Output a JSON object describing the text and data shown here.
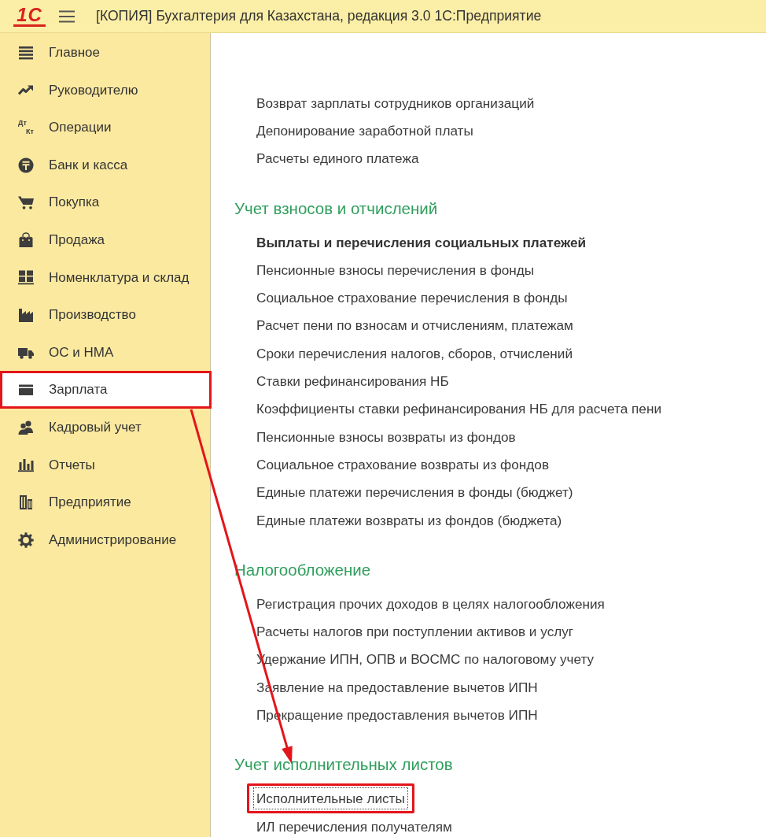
{
  "window": {
    "logo": "1С",
    "title": "[КОПИЯ] Бухгалтерия для Казахстана, редакция 3.0 1С:Предприятие"
  },
  "sidebar": {
    "items": [
      {
        "label": "Главное",
        "selected": false,
        "highlighted": false
      },
      {
        "label": "Руководителю",
        "selected": false,
        "highlighted": false
      },
      {
        "label": "Операции",
        "icon_text": [
          "Дт",
          "Кт"
        ],
        "selected": false,
        "highlighted": false
      },
      {
        "label": "Банк и касса",
        "selected": false,
        "highlighted": false
      },
      {
        "label": "Покупка",
        "selected": false,
        "highlighted": false
      },
      {
        "label": "Продажа",
        "selected": false,
        "highlighted": false
      },
      {
        "label": "Номенклатура и склад",
        "selected": false,
        "highlighted": false
      },
      {
        "label": "Производство",
        "selected": false,
        "highlighted": false
      },
      {
        "label": "ОС и НМА",
        "selected": false,
        "highlighted": false
      },
      {
        "label": "Зарплата",
        "selected": true,
        "highlighted": true
      },
      {
        "label": "Кадровый учет",
        "selected": false,
        "highlighted": false
      },
      {
        "label": "Отчеты",
        "selected": false,
        "highlighted": false
      },
      {
        "label": "Предприятие",
        "selected": false,
        "highlighted": false
      },
      {
        "label": "Администрирование",
        "selected": false,
        "highlighted": false
      }
    ]
  },
  "content": {
    "groups": [
      {
        "items": [
          {
            "label": "Возврат зарплаты сотрудников организаций",
            "bold": false,
            "focused": false,
            "highlighted": false
          },
          {
            "label": "Депонирование заработной платы",
            "bold": false,
            "focused": false,
            "highlighted": false
          },
          {
            "label": "Расчеты единого платежа",
            "bold": false,
            "focused": false,
            "highlighted": false
          }
        ]
      },
      {
        "heading": "Учет взносов и отчислений",
        "items": [
          {
            "label": "Выплаты и перечисления социальных платежей",
            "bold": true,
            "focused": false,
            "highlighted": false
          },
          {
            "label": "Пенсионные взносы перечисления в фонды",
            "bold": false,
            "focused": false,
            "highlighted": false
          },
          {
            "label": "Социальное страхование перечисления в фонды",
            "bold": false,
            "focused": false,
            "highlighted": false
          },
          {
            "label": "Расчет пени по взносам и отчислениям, платежам",
            "bold": false,
            "focused": false,
            "highlighted": false
          },
          {
            "label": "Сроки перечисления налогов, сборов, отчислений",
            "bold": false,
            "focused": false,
            "highlighted": false
          },
          {
            "label": "Ставки рефинансирования НБ",
            "bold": false,
            "focused": false,
            "highlighted": false
          },
          {
            "label": "Коэффициенты ставки рефинансирования НБ для расчета пени",
            "bold": false,
            "focused": false,
            "highlighted": false
          },
          {
            "label": "Пенсионные взносы возвраты из фондов",
            "bold": false,
            "focused": false,
            "highlighted": false
          },
          {
            "label": "Социальное страхование возвраты из фондов",
            "bold": false,
            "focused": false,
            "highlighted": false
          },
          {
            "label": "Единые платежи перечисления в фонды (бюджет)",
            "bold": false,
            "focused": false,
            "highlighted": false
          },
          {
            "label": "Единые платежи возвраты из фондов (бюджета)",
            "bold": false,
            "focused": false,
            "highlighted": false
          }
        ]
      },
      {
        "heading": "Налогообложение",
        "items": [
          {
            "label": "Регистрация прочих доходов в целях налогообложения",
            "bold": false,
            "focused": false,
            "highlighted": false
          },
          {
            "label": "Расчеты налогов при поступлении активов и услуг",
            "bold": false,
            "focused": false,
            "highlighted": false
          },
          {
            "label": "Удержание ИПН, ОПВ и ВОСМС по налоговому учету",
            "bold": false,
            "focused": false,
            "highlighted": false
          },
          {
            "label": "Заявление на предоставление вычетов ИПН",
            "bold": false,
            "focused": false,
            "highlighted": false
          },
          {
            "label": "Прекращение предоставления вычетов ИПН",
            "bold": false,
            "focused": false,
            "highlighted": false
          }
        ]
      },
      {
        "heading": "Учет исполнительных листов",
        "items": [
          {
            "label": "Исполнительные листы",
            "bold": false,
            "focused": true,
            "highlighted": true
          },
          {
            "label": "ИЛ перечисления получателям",
            "bold": false,
            "focused": false,
            "highlighted": false
          }
        ]
      }
    ]
  },
  "annotations": [
    {
      "kind": "arrow"
    }
  ]
}
